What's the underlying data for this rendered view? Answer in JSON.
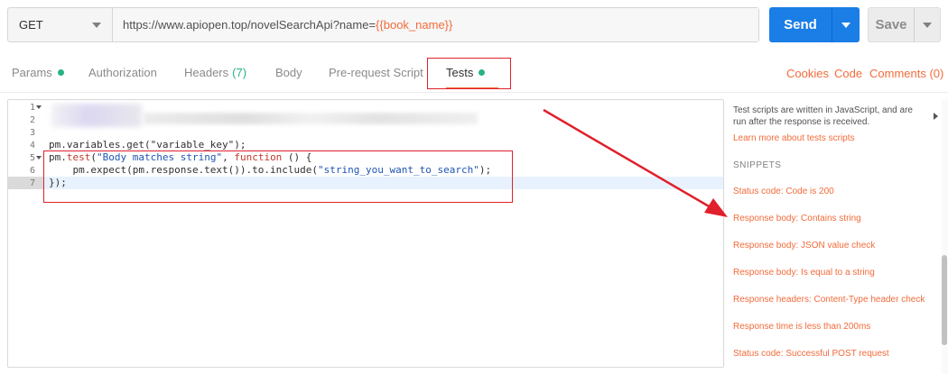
{
  "request": {
    "method": "GET",
    "url_prefix": "https://www.apiopen.top/novelSearchApi?name=",
    "url_variable": "{{book_name}}"
  },
  "actions": {
    "send_label": "Send",
    "save_label": "Save"
  },
  "tabs": [
    {
      "label": "Params"
    },
    {
      "label": "Authorization"
    },
    {
      "label": "Headers",
      "count": "(7)"
    },
    {
      "label": "Body"
    },
    {
      "label": "Pre-request Script"
    },
    {
      "label": "Tests"
    }
  ],
  "right_links": {
    "cookies": "Cookies",
    "code": "Code",
    "comments": "Comments (0)"
  },
  "editor": {
    "line_numbers": [
      "1",
      "2",
      "3",
      "4",
      "5",
      "6",
      "7"
    ],
    "line4": "pm.variables.get(\"variable_key\");",
    "line5_a": "pm.",
    "line5_b": "test",
    "line5_c": "(",
    "line5_d": "\"Body matches string\"",
    "line5_e": ", ",
    "line5_f": "function",
    "line5_g": " () {",
    "line6_a": "    pm.expect(pm.response.text()).to.include(",
    "line6_b": "\"string_you_want_to_search\"",
    "line6_c": ");",
    "line7": "});"
  },
  "side_panel": {
    "description": "Test scripts are written in JavaScript, and are run after the response is received.",
    "learn_more": "Learn more about tests scripts",
    "snippets_heading": "SNIPPETS",
    "snippets": [
      "Status code: Code is 200",
      "Response body: Contains string",
      "Response body: JSON value check",
      "Response body: Is equal to a string",
      "Response headers: Content-Type header check",
      "Response time is less than 200ms",
      "Status code: Successful POST request"
    ]
  },
  "colors": {
    "accent": "#f26b3a",
    "send": "#1a7ee6",
    "status_dot": "#26b47f",
    "annotation": "#e0202a"
  },
  "icons": [
    "chevron-down-icon",
    "status-dot-icon",
    "fold-arrow-icon",
    "expand-arrow-icon"
  ]
}
